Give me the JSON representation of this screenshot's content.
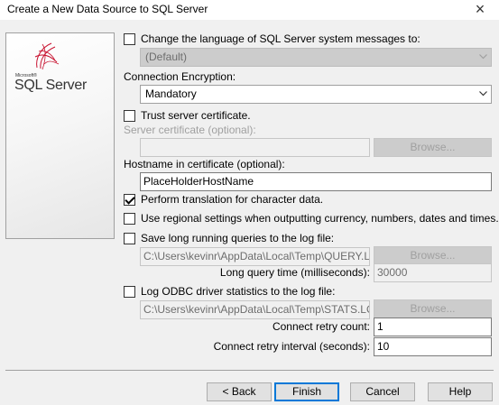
{
  "window": {
    "title": "Create a New Data Source to SQL Server",
    "close_glyph": "×"
  },
  "logo": {
    "microsoft": "Microsoft®",
    "product": "SQL Server",
    "icon": "sql-server-logo-icon"
  },
  "language": {
    "checkbox_label": "Change the language of SQL Server system messages to:",
    "checked": false,
    "value": "(Default)"
  },
  "encryption": {
    "label": "Connection Encryption:",
    "value": "Mandatory"
  },
  "trust": {
    "checkbox_label": "Trust server certificate.",
    "checked": false
  },
  "server_cert": {
    "label": "Server certificate (optional):",
    "value": "",
    "browse_label": "Browse..."
  },
  "hostname": {
    "label": "Hostname in certificate (optional):",
    "value": "PlaceHolderHostName"
  },
  "translation": {
    "checkbox_label": "Perform translation for character data.",
    "checked": true
  },
  "regional": {
    "checkbox_label": "Use regional settings when outputting currency, numbers, dates and times.",
    "checked": false
  },
  "long_queries": {
    "checkbox_label": "Save long running queries to the log file:",
    "checked": false,
    "path": "C:\\Users\\kevinr\\AppData\\Local\\Temp\\QUERY.LOG",
    "browse_label": "Browse...",
    "time_label": "Long query time (milliseconds):",
    "time_value": "30000"
  },
  "odbc_stats": {
    "checkbox_label": "Log ODBC driver statistics to the log file:",
    "checked": false,
    "path": "C:\\Users\\kevinr\\AppData\\Local\\Temp\\STATS.LOG",
    "browse_label": "Browse..."
  },
  "retry": {
    "count_label": "Connect retry count:",
    "count_value": "1",
    "interval_label": "Connect retry interval (seconds):",
    "interval_value": "10"
  },
  "buttons": {
    "back": "< Back",
    "finish": "Finish",
    "cancel": "Cancel",
    "help": "Help"
  },
  "colors": {
    "focus_border": "#0078d7",
    "disabled_text": "#a0a0a0",
    "logo_red": "#c8102e"
  }
}
